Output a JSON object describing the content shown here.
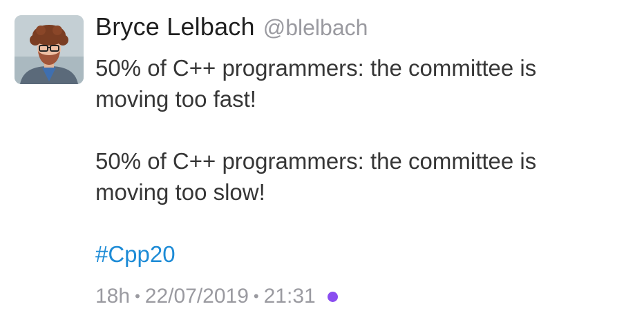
{
  "tweet": {
    "author": {
      "display_name": "Bryce Lelbach",
      "handle": "@blelbach"
    },
    "text": {
      "line1": "50% of C++ programmers: the committee is",
      "line2": "moving too fast!",
      "line3": "50% of C++ programmers: the committee is",
      "line4": "moving too slow!"
    },
    "hashtag": "#Cpp20",
    "meta": {
      "relative_time": "18h",
      "separator": "•",
      "date": "22/07/2019",
      "time": "21:31"
    },
    "colors": {
      "hashtag": "#1d8bd6",
      "status_dot": "#8a4df0"
    },
    "icons": {
      "avatar": "profile-photo-icon",
      "status": "purple-dot-icon"
    }
  }
}
